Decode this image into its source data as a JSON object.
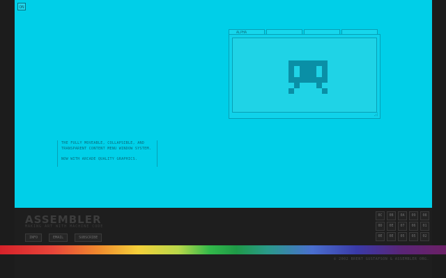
{
  "stage": {
    "on_label": "ON",
    "background": "#00cfe8"
  },
  "window": {
    "tabs": [
      {
        "label": "ALPHA"
      },
      {
        "label": ""
      },
      {
        "label": ""
      },
      {
        "label": ""
      }
    ],
    "icon": "space-invader-icon"
  },
  "description": {
    "line1": "THE FULLY MOVEABLE, COLLAPSIBLE, AND TRANSPARENT CONTENT MENU WINDOW SYSTEM.",
    "line2": "NOW WITH ARCADE QUALITY GRAPHICS."
  },
  "footer": {
    "brand": "ASSEMBLER",
    "tagline": "MAKING ART WITH MACHINE CODE",
    "nav": [
      "INFO",
      "EMAIL",
      "SUBSCRIBE"
    ],
    "grid": [
      "0C",
      "0B",
      "0A",
      "09",
      "08",
      "0D",
      "0E",
      "07",
      "06",
      "01",
      "0E",
      "0E",
      "05",
      "05",
      "02"
    ],
    "copyright": "© 2002 BRENT GUSTAFSON & ASSEMBLER ORG."
  }
}
